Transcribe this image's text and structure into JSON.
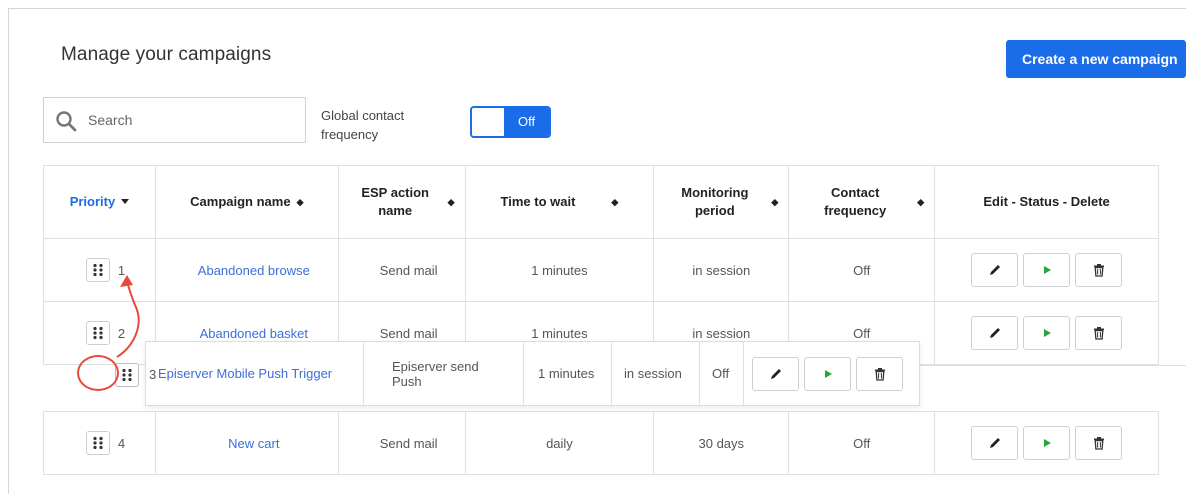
{
  "page": {
    "title": "Manage your campaigns",
    "create_label": "Create a new campaign"
  },
  "search": {
    "placeholder": "Search",
    "value": ""
  },
  "global_frequency": {
    "label": "Global contact frequency",
    "state_label": "Off",
    "enabled": false
  },
  "columns": [
    {
      "label": "Priority",
      "sort": "dropdown"
    },
    {
      "label": "Campaign name",
      "sort": "sortable"
    },
    {
      "label": "ESP action name",
      "sort": "sortable"
    },
    {
      "label": "Time to wait",
      "sort": "sortable"
    },
    {
      "label": "Monitoring period",
      "sort": "sortable"
    },
    {
      "label": "Contact frequency",
      "sort": "sortable"
    },
    {
      "label": "Edit - Status - Delete",
      "sort": "none"
    }
  ],
  "rows": [
    {
      "priority": "1",
      "name": "Abandoned browse",
      "esp": "Send mail",
      "wait": "1 minutes",
      "period": "in session",
      "frequency": "Off"
    },
    {
      "priority": "2",
      "name": "Abandoned basket",
      "esp": "Send mail",
      "wait": "1 minutes",
      "period": "in session",
      "frequency": "Off"
    },
    {
      "priority": "4",
      "name": "New cart",
      "esp": "Send mail",
      "wait": "daily",
      "period": "30 days",
      "frequency": "Off"
    }
  ],
  "dragging_row": {
    "priority": "3",
    "name": "Episerver Mobile Push Trigger",
    "esp": "Episerver send Push",
    "wait": "1 minutes",
    "period": "in session",
    "frequency": "Off"
  },
  "icons": {
    "search": "search-icon",
    "drag": "drag-handle-icon",
    "edit": "pencil-icon",
    "status": "play-icon",
    "delete": "trash-icon",
    "sort": "sort-icon",
    "dropdown": "caret-down-icon"
  },
  "colors": {
    "accent": "#1a6ce8",
    "link": "#3a6fd8",
    "status": "#2aa53a",
    "annotation": "#e84a3c"
  }
}
